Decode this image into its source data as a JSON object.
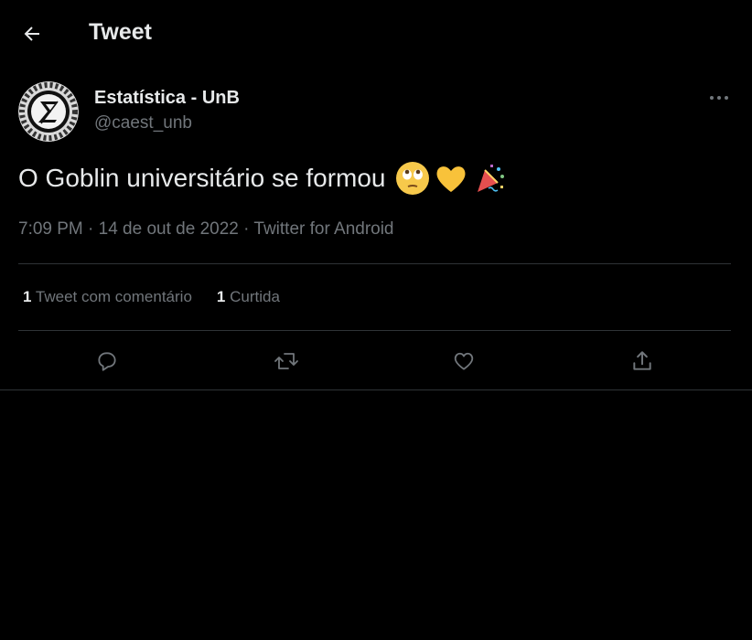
{
  "header": {
    "title": "Tweet",
    "back_icon": "arrow-left-icon"
  },
  "author": {
    "name": "Estatística - UnB",
    "handle": "@caest_unb",
    "avatar_icon": "sigma-gear-logo"
  },
  "tweet": {
    "text": "O Goblin universitário se formou",
    "emojis": [
      "face-with-rolling-eyes",
      "yellow-heart",
      "party-popper"
    ],
    "meta": "7:09 PM · 14 de out de 2022 · Twitter for Android"
  },
  "stats": {
    "quote_count": "1",
    "quote_label": "Tweet com comentário",
    "like_count": "1",
    "like_label": "Curtida"
  },
  "actions": [
    "reply-icon",
    "retweet-icon",
    "like-icon",
    "share-icon"
  ],
  "colors": {
    "background": "#000000",
    "text": "#e7e9ea",
    "secondary": "#71767b",
    "divider": "#2f3336"
  }
}
